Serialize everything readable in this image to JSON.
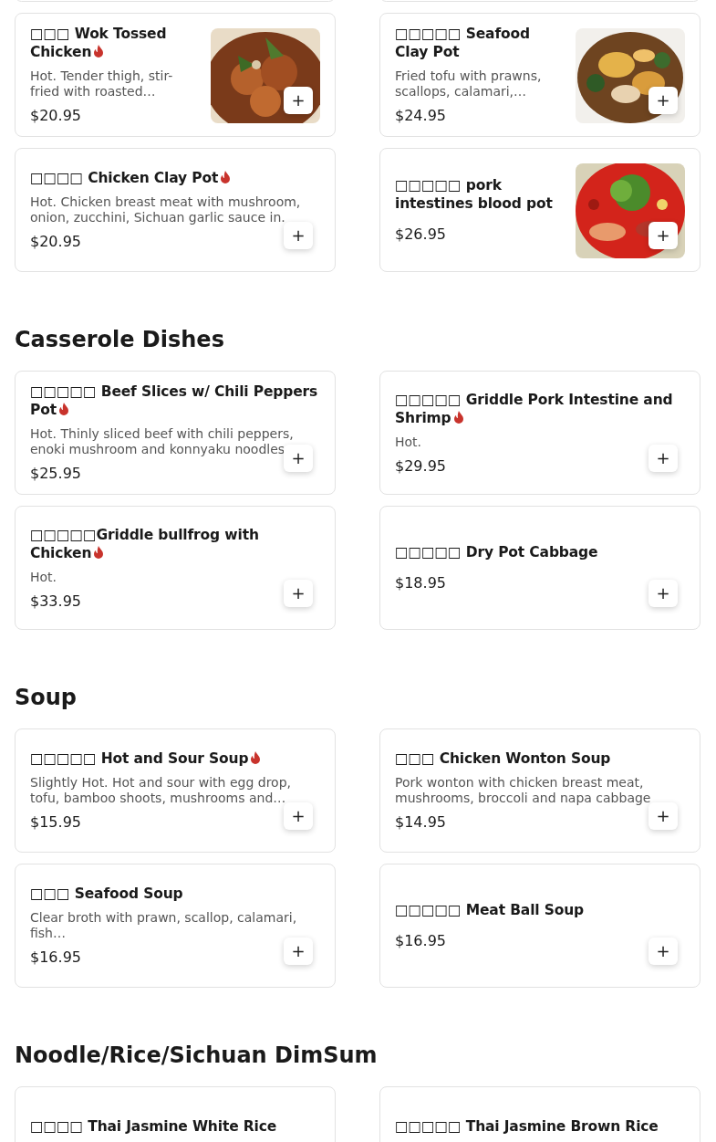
{
  "sections": [
    {
      "items": [
        {
          "kind": "cut_off"
        },
        {
          "kind": "cut_off"
        },
        {
          "kind": "card",
          "title": "□□□ Wok Tossed Chicken",
          "spicy": true,
          "description": "Hot. Tender thigh, stir-fried with roasted…",
          "price": "$20.95",
          "add_button": "+"
        },
        {
          "kind": "card",
          "title": "□□□□□ Seafood Clay Pot",
          "spicy": false,
          "description": "Fried tofu with prawns, scallops, calamari,…",
          "price": "$24.95",
          "add_button": "+"
        },
        {
          "kind": "card",
          "title": "□□□□ Chicken Clay Pot",
          "spicy": true,
          "description": "Hot. Chicken breast meat with mushroom, onion, zucchini, Sichuan garlic sauce in.",
          "price": "$20.95",
          "add_button": "+"
        },
        {
          "kind": "card",
          "title": "□□□□□ pork intestines blood pot",
          "spicy": false,
          "price": "$26.95",
          "add_button": "+"
        }
      ]
    },
    {
      "title": "Casserole Dishes",
      "items": [
        {
          "kind": "card",
          "title": "□□□□□ Beef Slices w/ Chili Peppers Pot",
          "spicy": true,
          "description": "Hot. Thinly sliced beef with chili peppers, enoki mushroom and konnyaku noodles",
          "price": "$25.95",
          "add_button": "+"
        },
        {
          "kind": "card",
          "title": "□□□□□ Griddle Pork Intestine and Shrimp",
          "spicy": true,
          "description": "Hot.",
          "price": "$29.95",
          "add_button": "+"
        },
        {
          "kind": "card",
          "title": "□□□□□Griddle bullfrog with Chicken",
          "spicy": true,
          "description": "Hot.",
          "price": "$33.95",
          "add_button": "+"
        },
        {
          "kind": "card",
          "title": "□□□□□ Dry Pot Cabbage",
          "spicy": false,
          "price": "$18.95",
          "add_button": "+"
        }
      ]
    },
    {
      "title": "Soup",
      "items": [
        {
          "kind": "card",
          "title": "□□□□□ Hot and Sour Soup",
          "spicy": true,
          "description": "Slightly Hot. Hot and sour with egg drop, tofu, bamboo shoots, mushrooms and…",
          "price": "$15.95",
          "add_button": "+"
        },
        {
          "kind": "card",
          "title": "□□□ Chicken Wonton Soup",
          "spicy": false,
          "description": "Pork wonton with chicken breast meat, mushrooms, broccoli and napa cabbage",
          "price": "$14.95",
          "add_button": "+"
        },
        {
          "kind": "card",
          "title": "□□□ Seafood Soup",
          "spicy": false,
          "description": "Clear broth with prawn, scallop, calamari, fish…",
          "price": "$16.95",
          "add_button": "+"
        },
        {
          "kind": "card",
          "title": "□□□□□ Meat Ball Soup",
          "spicy": false,
          "price": "$16.95",
          "add_button": "+"
        }
      ]
    },
    {
      "title": "Noodle/Rice/Sichuan DimSum",
      "items": [
        {
          "kind": "cut_title",
          "title": "□□□□ Thai Jasmine White Rice"
        },
        {
          "kind": "cut_title",
          "title": "□□□□□ Thai Jasmine Brown Rice"
        }
      ]
    }
  ]
}
